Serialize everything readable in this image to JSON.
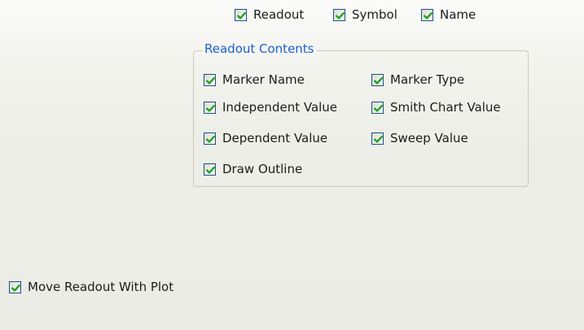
{
  "top_options": {
    "readout": {
      "label": "Readout",
      "checked": true
    },
    "symbol": {
      "label": "Symbol",
      "checked": true
    },
    "name": {
      "label": "Name",
      "checked": true
    }
  },
  "readout_contents": {
    "title": "Readout Contents",
    "marker_name": {
      "label": "Marker Name",
      "checked": true
    },
    "marker_type": {
      "label": "Marker Type",
      "checked": true
    },
    "independent_value": {
      "label": "Independent Value",
      "checked": true
    },
    "smith_chart_value": {
      "label": "Smith Chart Value",
      "checked": true
    },
    "dependent_value": {
      "label": "Dependent Value",
      "checked": true
    },
    "sweep_value": {
      "label": "Sweep Value",
      "checked": true
    },
    "draw_outline": {
      "label": "Draw Outline",
      "checked": true
    }
  },
  "move_readout_with_plot": {
    "label": "Move Readout With Plot",
    "checked": true
  },
  "colors": {
    "checkbox_border": "#1c5180",
    "checkmark": "#21a121",
    "group_title": "#1a5fd3",
    "group_border": "#c9c9bd"
  }
}
